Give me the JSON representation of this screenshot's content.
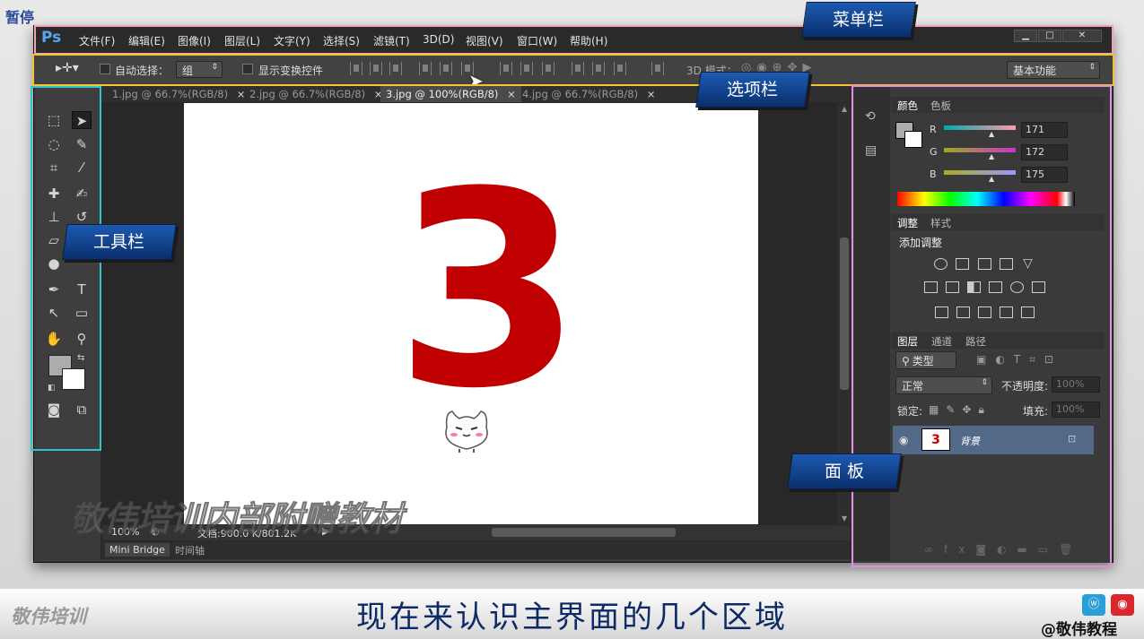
{
  "overlay": {
    "pause_label": "暂停"
  },
  "app": {
    "logo": "Ps"
  },
  "menu": [
    "文件(F)",
    "编辑(E)",
    "图像(I)",
    "图层(L)",
    "文字(Y)",
    "选择(S)",
    "滤镜(T)",
    "3D(D)",
    "视图(V)",
    "窗口(W)",
    "帮助(H)"
  ],
  "window_controls": {
    "minimize": "▁",
    "maximize": "□",
    "close": "✕"
  },
  "options": {
    "auto_select_label": "自动选择：",
    "auto_select_value": "组",
    "show_transform_label": "显示变换控件",
    "mode_3d_label": "3D 模式：",
    "workspace": "基本功能"
  },
  "tabs": [
    {
      "label": "1.jpg @ 66.7%(RGB/8)",
      "close": "×"
    },
    {
      "label": "2.jpg @ 66.7%(RGB/8)",
      "close": "×"
    },
    {
      "label": "3.jpg @ 100%(RGB/8)",
      "close": "×"
    },
    {
      "label": "4.jpg @ 66.7%(RGB/8)",
      "close": "×"
    }
  ],
  "canvas": {
    "digit": "3"
  },
  "status": {
    "zoom": "100%",
    "doc": "文档:900.0 K/801.2K"
  },
  "bottom_tabs": {
    "mini_bridge": "Mini Bridge",
    "timeline": "时间轴"
  },
  "watermark": "敬伟培训内部附赠教材",
  "color_panel": {
    "tab_color": "颜色",
    "tab_swatches": "色板",
    "r_label": "R",
    "g_label": "G",
    "b_label": "B",
    "r": "171",
    "g": "172",
    "b": "175"
  },
  "adjust_panel": {
    "tab_adjust": "调整",
    "tab_styles": "样式",
    "title": "添加调整"
  },
  "layers_panel": {
    "tab_layers": "图层",
    "tab_channels": "通道",
    "tab_paths": "路径",
    "filter": "类型",
    "blend": "正常",
    "opacity_label": "不透明度:",
    "opacity": "100%",
    "lock_label": "锁定:",
    "fill_label": "填充:",
    "fill": "100%",
    "layer_name": "背景",
    "thumb_digit": "3"
  },
  "labels": {
    "menubar": "菜单栏",
    "optionsbar": "选项栏",
    "toolbar": "工具栏",
    "panels": "面 板"
  },
  "caption": "现在来认识主界面的几个区域",
  "brand": "敬伟培训",
  "weibo": "@敬伟教程",
  "colors": {
    "menubar_frame": "#f5a0b5",
    "options_frame": "#f2c230",
    "toolbar_frame": "#2ec4d2",
    "panels_frame": "#e58ee0",
    "caption_text": "#0e2a66",
    "digit": "#c00000"
  }
}
